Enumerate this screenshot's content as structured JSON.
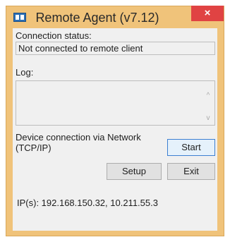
{
  "window": {
    "title": "Remote Agent (v7.12)",
    "close_glyph": "×",
    "app_icon": "remote-agent-app-icon",
    "colors": {
      "frame": "#f0c37a",
      "close": "#e04343",
      "client": "#f0f0f0",
      "default_button_border": "#3c7fd1"
    }
  },
  "connection": {
    "label": "Connection status:",
    "value": "Not connected to remote client"
  },
  "log": {
    "label": "Log:",
    "content": "",
    "scroll_up_glyph": "^",
    "scroll_down_glyph": "v"
  },
  "device": {
    "label_line1": "Device connection via Network",
    "label_line2": "(TCP/IP)"
  },
  "buttons": {
    "start": "Start",
    "setup": "Setup",
    "exit": "Exit"
  },
  "ip": {
    "text": "IP(s): 192.168.150.32, 10.211.55.3"
  }
}
